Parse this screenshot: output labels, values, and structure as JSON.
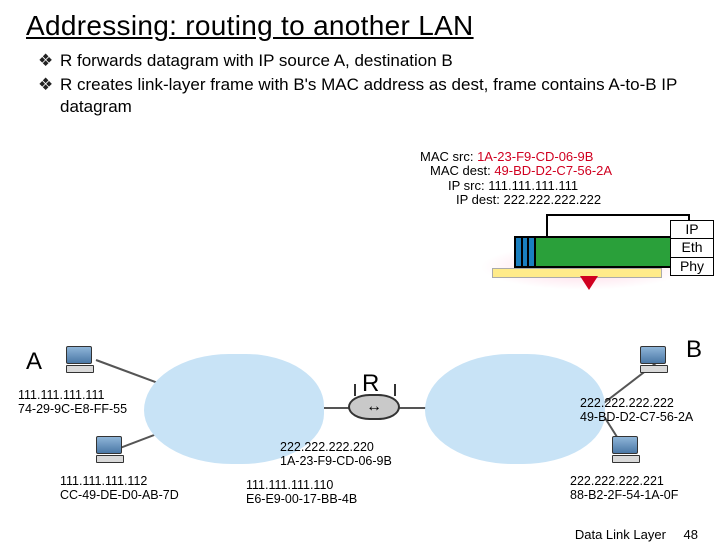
{
  "title": "Addressing: routing to another LAN",
  "bullets": [
    "R forwards datagram with IP source A, destination B",
    "R creates link-layer frame with B's MAC address as dest, frame contains A-to-B IP datagram"
  ],
  "packet": {
    "mac_src_label": "MAC src:",
    "mac_src_value": "1A-23-F9-CD-06-9B",
    "mac_dest_label": "MAC dest:",
    "mac_dest_value": "49-BD-D2-C7-56-2A",
    "ip_src_label": "IP src:",
    "ip_src_value": "111.111.111.111",
    "ip_dest_label": "IP dest:",
    "ip_dest_value": "222.222.222.222"
  },
  "stack": {
    "ip": "IP",
    "eth": "Eth",
    "phy": "Phy"
  },
  "labels": {
    "A": "A",
    "B": "B",
    "R": "R"
  },
  "nodes": {
    "A": {
      "ip": "111.111.111.111",
      "mac": "74-29-9C-E8-FF-55"
    },
    "C": {
      "ip": "111.111.111.112",
      "mac": "CC-49-DE-D0-AB-7D"
    },
    "R_l": {
      "ip": "111.111.111.110",
      "mac": "E6-E9-00-17-BB-4B"
    },
    "R_r": {
      "ip": "222.222.222.220",
      "mac": "1A-23-F9-CD-06-9B"
    },
    "B": {
      "ip": "222.222.222.222",
      "mac": "49-BD-D2-C7-56-2A"
    },
    "F": {
      "ip": "222.222.222.221",
      "mac": "88-B2-2F-54-1A-0F"
    }
  },
  "footer": {
    "label": "Data Link Layer",
    "page": "48"
  }
}
